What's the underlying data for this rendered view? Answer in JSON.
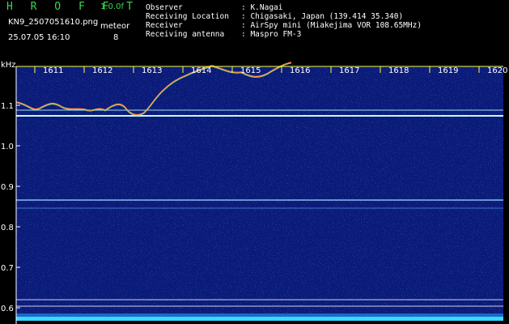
{
  "header": {
    "brand": "H R O F F T",
    "version": "1.0.0f",
    "filename": "KN9_2507051610.png",
    "datetime": "25.07.05 16:10",
    "meteor_label": "meteor",
    "meteor_count": "8",
    "info": [
      {
        "key": "Observer",
        "value": ": K.Nagai"
      },
      {
        "key": "Receiving Location",
        "value": ": Chigasaki, Japan (139.414 35.340)"
      },
      {
        "key": "Receiver",
        "value": ": AirSpy mini (Miakejima VOR 108.65MHz)"
      },
      {
        "key": "Receiving antenna",
        "value": ": Maspro FM-3"
      }
    ]
  },
  "spectrogram": {
    "y_unit": "kHz",
    "y_ticks": [
      "1.1",
      "1.0",
      "0.9",
      "0.8",
      "0.7",
      "0.6"
    ],
    "x_ticks": [
      "1611",
      "1612",
      "1613",
      "1614",
      "1615",
      "1616",
      "1617",
      "1618",
      "1619",
      "1620"
    ],
    "background_color": "#0a1a78",
    "tick_color": "#ffff40"
  }
}
